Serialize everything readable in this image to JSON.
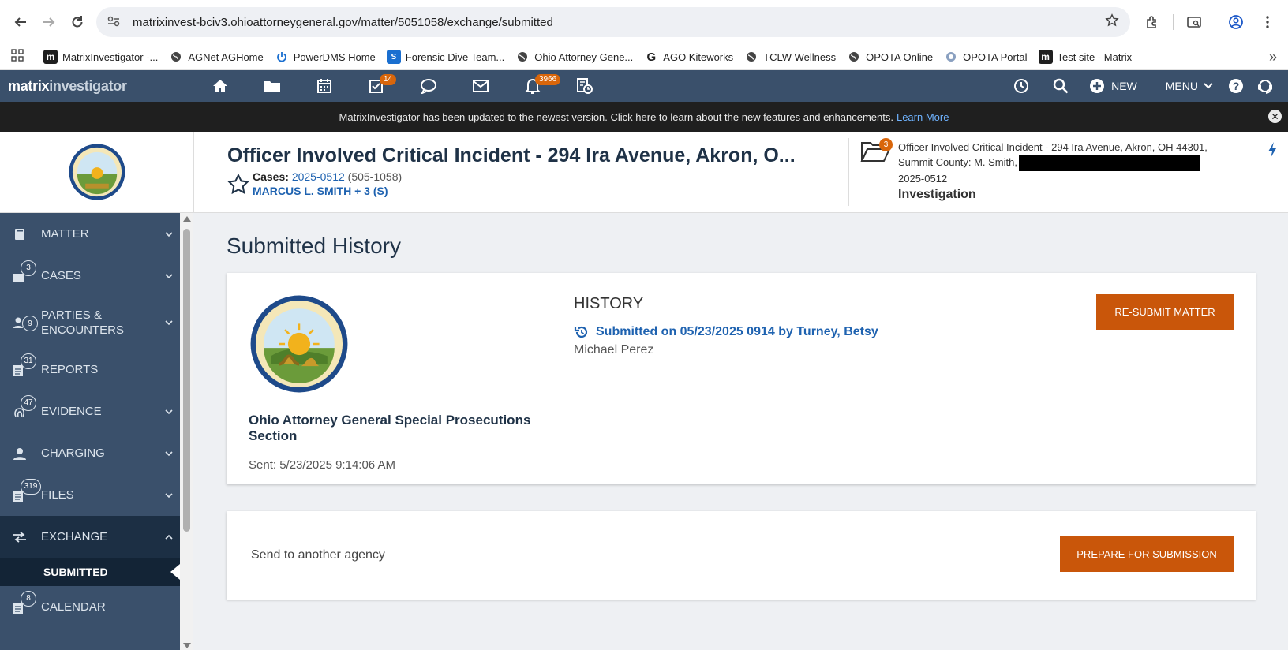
{
  "browser": {
    "url": "matrixinvest-bciv3.ohioattorneygeneral.gov/matter/5051058/exchange/submitted",
    "bookmarks": [
      {
        "label": "MatrixInvestigator -..."
      },
      {
        "label": "AGNet AGHome"
      },
      {
        "label": "PowerDMS Home"
      },
      {
        "label": "Forensic Dive Team..."
      },
      {
        "label": "Ohio Attorney Gene..."
      },
      {
        "label": "AGO Kiteworks"
      },
      {
        "label": "TCLW Wellness"
      },
      {
        "label": "OPOTA Online"
      },
      {
        "label": "OPOTA Portal"
      },
      {
        "label": "Test site - Matrix"
      }
    ],
    "more_glyph": "»"
  },
  "app": {
    "brand_a": "matrix",
    "brand_b": "investigator",
    "tasks_badge": "14",
    "notifications_badge": "3966",
    "new_label": "NEW",
    "menu_label": "MENU"
  },
  "notice": {
    "text": "MatrixInvestigator has been updated to the newest version. Click here to learn about the new features and enhancements.",
    "link": "Learn More"
  },
  "matter": {
    "title": "Officer Involved Critical Incident - 294 Ira Avenue, Akron, O...",
    "cases_label": "Cases:",
    "case_link": "2025-0512",
    "case_paren": "(505-1058)",
    "parties": "MARCUS L. SMITH + 3 (S)",
    "folder_badge": "3",
    "right_line1": "Officer Involved Critical Incident - 294 Ira Avenue, Akron, OH 44301,",
    "right_line2": "Summit County: M. Smith,",
    "right_line3": "2025-0512",
    "right_status": "Investigation"
  },
  "sidebar": {
    "items": [
      {
        "label": "MATTER",
        "badge": ""
      },
      {
        "label": "CASES",
        "badge": "3"
      },
      {
        "label": "PARTIES &",
        "label2": "ENCOUNTERS",
        "badge": "9"
      },
      {
        "label": "REPORTS",
        "badge": "31"
      },
      {
        "label": "EVIDENCE",
        "badge": "47"
      },
      {
        "label": "CHARGING",
        "badge": ""
      },
      {
        "label": "FILES",
        "badge": "319"
      },
      {
        "label": "EXCHANGE",
        "badge": ""
      },
      {
        "label": "CALENDAR",
        "badge": "8"
      }
    ],
    "sub_label": "SUBMITTED"
  },
  "content": {
    "page_title": "Submitted History",
    "agency": "Ohio Attorney General Special Prosecutions Section",
    "sent": "Sent: 5/23/2025 9:14:06 AM",
    "history_heading": "HISTORY",
    "history_entry": "Submitted on 05/23/2025 0914 by Turney, Betsy",
    "history_name": "Michael Perez",
    "resubmit_label": "RE-SUBMIT MATTER",
    "send_text": "Send to another agency",
    "prepare_label": "PREPARE FOR SUBMISSION"
  },
  "colors": {
    "header": "#3a506b",
    "accent_orange": "#c9560a",
    "link_blue": "#1e62b0",
    "notice_bg": "#1f1f1f"
  }
}
